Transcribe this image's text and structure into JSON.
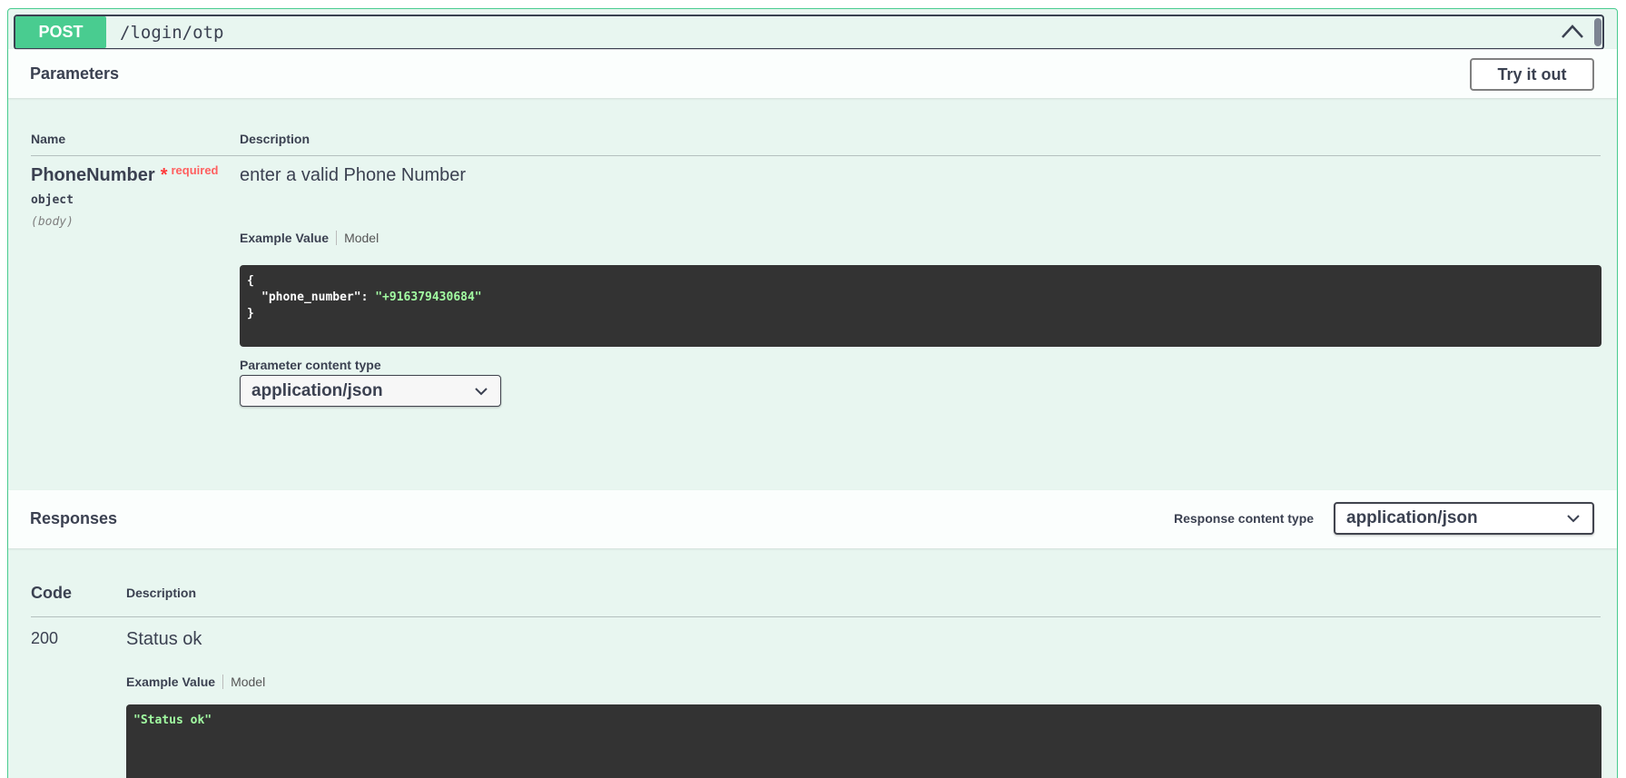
{
  "operation": {
    "method": "POST",
    "path": "/login/otp"
  },
  "parameters": {
    "title": "Parameters",
    "try_label": "Try it out",
    "col_name": "Name",
    "col_description": "Description",
    "param": {
      "name": "PhoneNumber",
      "star": "*",
      "required": "required",
      "type": "object",
      "in": "(body)",
      "description": "enter a valid Phone Number",
      "tab_example": "Example Value",
      "tab_model": "Model",
      "example_open": "{",
      "example_key": "\"phone_number\"",
      "example_colon": ": ",
      "example_value": "\"+916379430684\"",
      "example_close": "}",
      "content_type_label": "Parameter content type",
      "content_type_value": "application/json"
    }
  },
  "responses": {
    "title": "Responses",
    "content_type_label": "Response content type",
    "content_type_value": "application/json",
    "col_code": "Code",
    "col_description": "Description",
    "rows": [
      {
        "code": "200",
        "description": "Status ok",
        "tab_example": "Example Value",
        "tab_model": "Model",
        "example": "\"Status ok\""
      }
    ]
  },
  "colors": {
    "post": "#49cc90",
    "background": "#e8f6f0",
    "code_bg": "#333333",
    "string": "#a2fca2",
    "required": "#ff3b3b"
  },
  "icons": {
    "collapse": "chevron-up-icon",
    "dropdown": "chevron-down-icon"
  }
}
